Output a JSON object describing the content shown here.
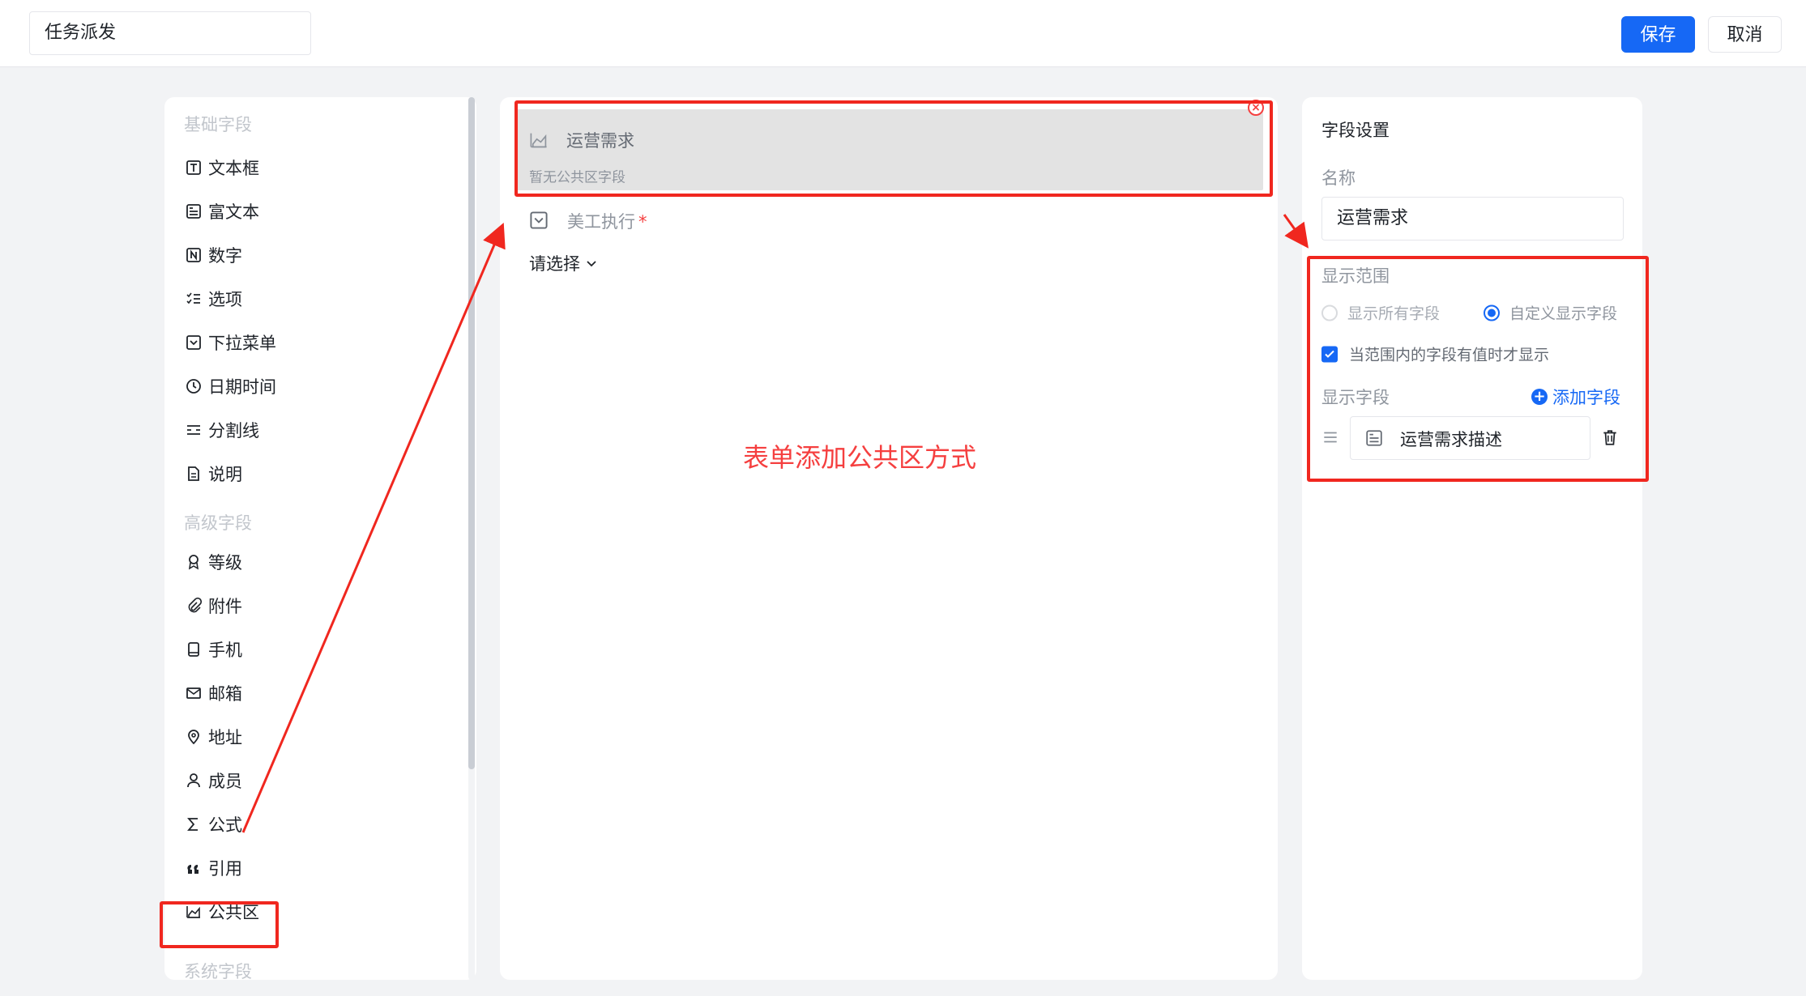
{
  "header": {
    "title_value": "任务派发",
    "save_label": "保存",
    "cancel_label": "取消"
  },
  "sidebar": {
    "basic_group": "基础字段",
    "basic_items": [
      {
        "label": "文本框",
        "icon": "text-box-icon"
      },
      {
        "label": "富文本",
        "icon": "rich-text-icon"
      },
      {
        "label": "数字",
        "icon": "number-icon"
      },
      {
        "label": "选项",
        "icon": "options-list-icon"
      },
      {
        "label": "下拉菜单",
        "icon": "dropdown-icon"
      },
      {
        "label": "日期时间",
        "icon": "clock-icon"
      },
      {
        "label": "分割线",
        "icon": "divider-icon"
      },
      {
        "label": "说明",
        "icon": "document-icon"
      }
    ],
    "advanced_group": "高级字段",
    "advanced_items": [
      {
        "label": "等级",
        "icon": "award-icon"
      },
      {
        "label": "附件",
        "icon": "paperclip-icon"
      },
      {
        "label": "手机",
        "icon": "phone-icon"
      },
      {
        "label": "邮箱",
        "icon": "mail-icon"
      },
      {
        "label": "地址",
        "icon": "location-pin-icon"
      },
      {
        "label": "成员",
        "icon": "user-icon"
      },
      {
        "label": "公式",
        "icon": "sigma-icon"
      },
      {
        "label": "引用",
        "icon": "quote-icon"
      },
      {
        "label": "公共区",
        "icon": "area-chart-icon"
      }
    ],
    "system_group": "系统字段"
  },
  "canvas": {
    "public_area_title": "运营需求",
    "public_area_empty": "暂无公共区字段",
    "dropdown_label": "美工执行",
    "required_mark": "*",
    "select_placeholder": "请选择",
    "annotation": "表单添加公共区方式"
  },
  "settings": {
    "heading": "字段设置",
    "name_label": "名称",
    "name_value": "运营需求",
    "display_range_label": "显示范围",
    "radio_all": "显示所有字段",
    "radio_custom": "自定义显示字段",
    "radio_selected": "custom",
    "checkbox_label": "当范围内的字段有值时才显示",
    "checkbox_checked": true,
    "display_fields_label": "显示字段",
    "add_field_label": "添加字段",
    "display_fields": [
      {
        "label": "运营需求描述",
        "icon": "rich-text-icon"
      }
    ]
  },
  "colors": {
    "primary": "#1668f5",
    "annotation_red": "#f0271f"
  }
}
